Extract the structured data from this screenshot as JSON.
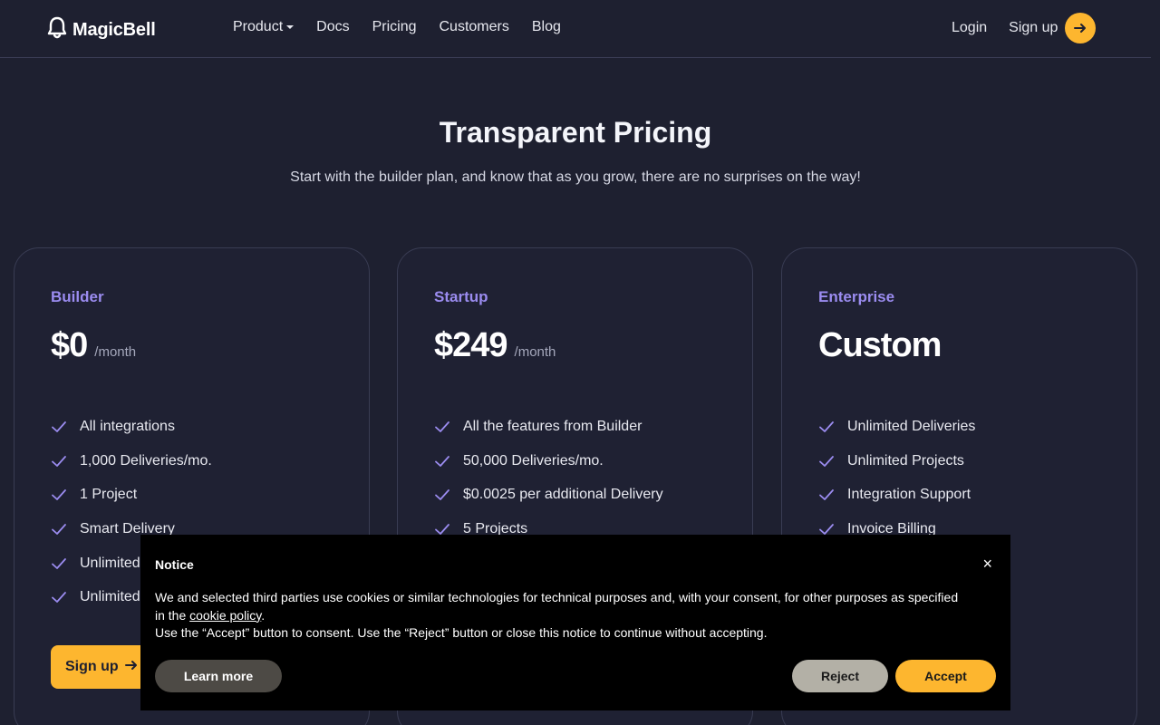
{
  "header": {
    "logo_text": "MagicBell",
    "nav": [
      "Product",
      "Docs",
      "Pricing",
      "Customers",
      "Blog"
    ],
    "login": "Login",
    "signup": "Sign up"
  },
  "hero": {
    "title": "Transparent Pricing",
    "subtitle": "Start with the builder plan, and know that as you grow, there are no surprises on the way!"
  },
  "plans": [
    {
      "name": "Builder",
      "price": "$0",
      "period": "/month",
      "features": [
        "All integrations",
        "1,000 Deliveries/mo.",
        "1 Project",
        "Smart Delivery",
        "Unlimited",
        "Unlimited"
      ],
      "cta": "Sign up"
    },
    {
      "name": "Startup",
      "price": "$249",
      "period": "/month",
      "features": [
        "All the features from Builder",
        "50,000 Deliveries/mo.",
        "$0.0025 per additional Delivery",
        "5 Projects"
      ]
    },
    {
      "name": "Enterprise",
      "price": "Custom",
      "features": [
        "Unlimited Deliveries",
        "Unlimited Projects",
        "Integration Support",
        "Invoice Billing"
      ]
    }
  ],
  "cookie_notice": {
    "title": "Notice",
    "close": "×",
    "body_part1": "We and selected third parties use cookies or similar technologies for technical purposes and, with your consent, for other purposes as specified in the ",
    "link_text": "cookie policy",
    "body_part2": ".",
    "body_line2": "Use the “Accept” button to consent. Use the “Reject” button or close this notice to continue without accepting.",
    "learn_more": "Learn more",
    "reject": "Reject",
    "accept": "Accept"
  },
  "colors": {
    "background": "#1e2030",
    "accent": "#fdb62f",
    "plan_name": "#9b8cf0"
  }
}
